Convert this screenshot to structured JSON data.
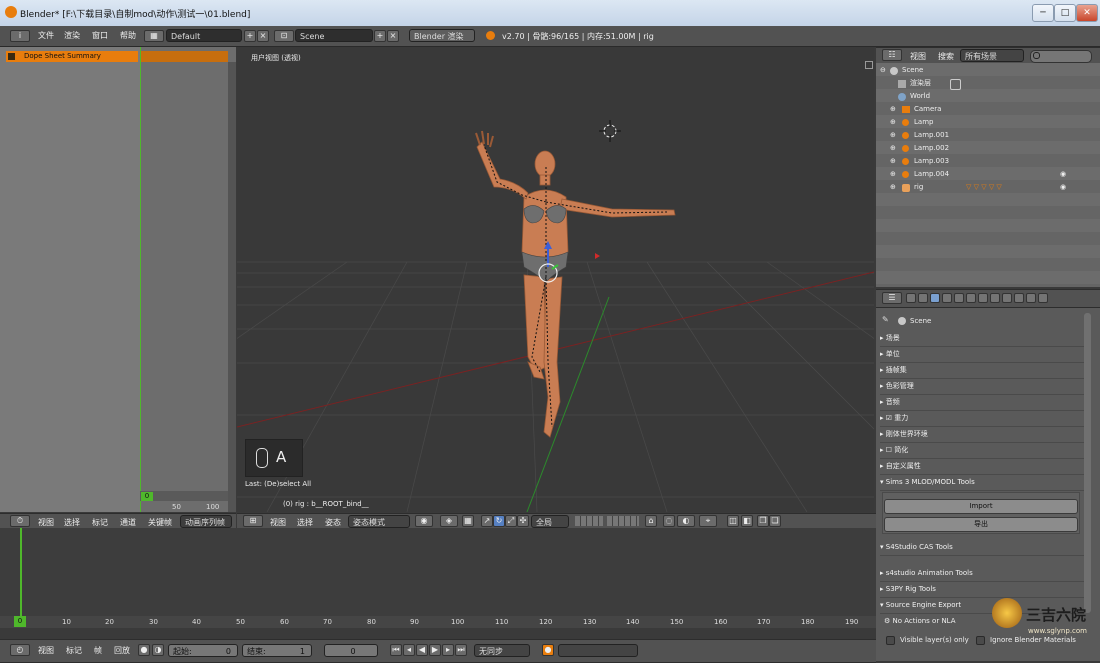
{
  "window": {
    "title": "Blender* [F:\\下载目录\\自制mod\\动作\\测试一\\01.blend]",
    "controls": {
      "minimize": "─",
      "maximize": "□",
      "close": "✕"
    }
  },
  "info_header": {
    "menus": [
      "文件",
      "渲染",
      "窗口",
      "帮助"
    ],
    "layout": "Default",
    "scene": "Scene",
    "engine": "Blender 渲染",
    "stats": "v2.70 | 骨骼:96/165 | 内存:51.00M | rig"
  },
  "dope_sheet": {
    "summary": "Dope Sheet Summary",
    "current_frame": "0",
    "ruler": [
      "50",
      "100"
    ],
    "menus": [
      "视图",
      "选择",
      "标记",
      "通道",
      "关键帧"
    ],
    "mode": "动画序列帧"
  },
  "viewport": {
    "label": "用户视图 (透视)",
    "key_hint": "A",
    "last_op": "Last: (De)select All",
    "object_info": "(0) rig : b__ROOT_bind__",
    "menus": [
      "视图",
      "选择",
      "姿态"
    ],
    "mode": "姿态模式",
    "orientation": "全局"
  },
  "outliner": {
    "menus": [
      "视图",
      "搜索"
    ],
    "filter": "所有场景",
    "items": [
      {
        "label": "Scene",
        "indent": 0
      },
      {
        "label": "渲染层",
        "indent": 1
      },
      {
        "label": "World",
        "indent": 1
      },
      {
        "label": "Camera",
        "indent": 1
      },
      {
        "label": "Lamp",
        "indent": 1
      },
      {
        "label": "Lamp.001",
        "indent": 1
      },
      {
        "label": "Lamp.002",
        "indent": 1
      },
      {
        "label": "Lamp.003",
        "indent": 1
      },
      {
        "label": "Lamp.004",
        "indent": 1
      },
      {
        "label": "rig",
        "indent": 1
      }
    ]
  },
  "properties": {
    "context": "Scene",
    "panels": [
      "场景",
      "单位",
      "插帧集",
      "色彩管理",
      "音频",
      "重力",
      "刚体世界环境",
      "简化",
      "自定义属性"
    ],
    "sims_panel": {
      "title": "Sims 3 MLOD/MODL Tools",
      "import": "Import",
      "export": "导出"
    },
    "s4_cas": "S4Studio CAS Tools",
    "s4_anim": "s4studio Animation Tools",
    "s3py": "S3PY Rig Tools",
    "source_panel": {
      "title": "Source Engine Export",
      "no_actions": "No Actions or NLA",
      "visible_layers": "Visible layer(s) only",
      "ignore_mats": "Ignore Blender Materials"
    }
  },
  "timeline": {
    "ticks": [
      "0",
      "10",
      "20",
      "30",
      "40",
      "50",
      "60",
      "70",
      "80",
      "90",
      "100",
      "110",
      "120",
      "130",
      "140",
      "150",
      "160",
      "170",
      "180",
      "190"
    ],
    "menus": [
      "视图",
      "标记",
      "帧",
      "回放"
    ],
    "start_label": "起始:",
    "start": "0",
    "end_label": "结束:",
    "end": "1",
    "current": "0",
    "sync": "无同步"
  },
  "watermark": {
    "text": "三吉六院",
    "url": "www.sglynp.com"
  },
  "colors": {
    "accent": "#e87d0d",
    "selected": "#5680c2",
    "green_frame": "#4fb82b"
  }
}
